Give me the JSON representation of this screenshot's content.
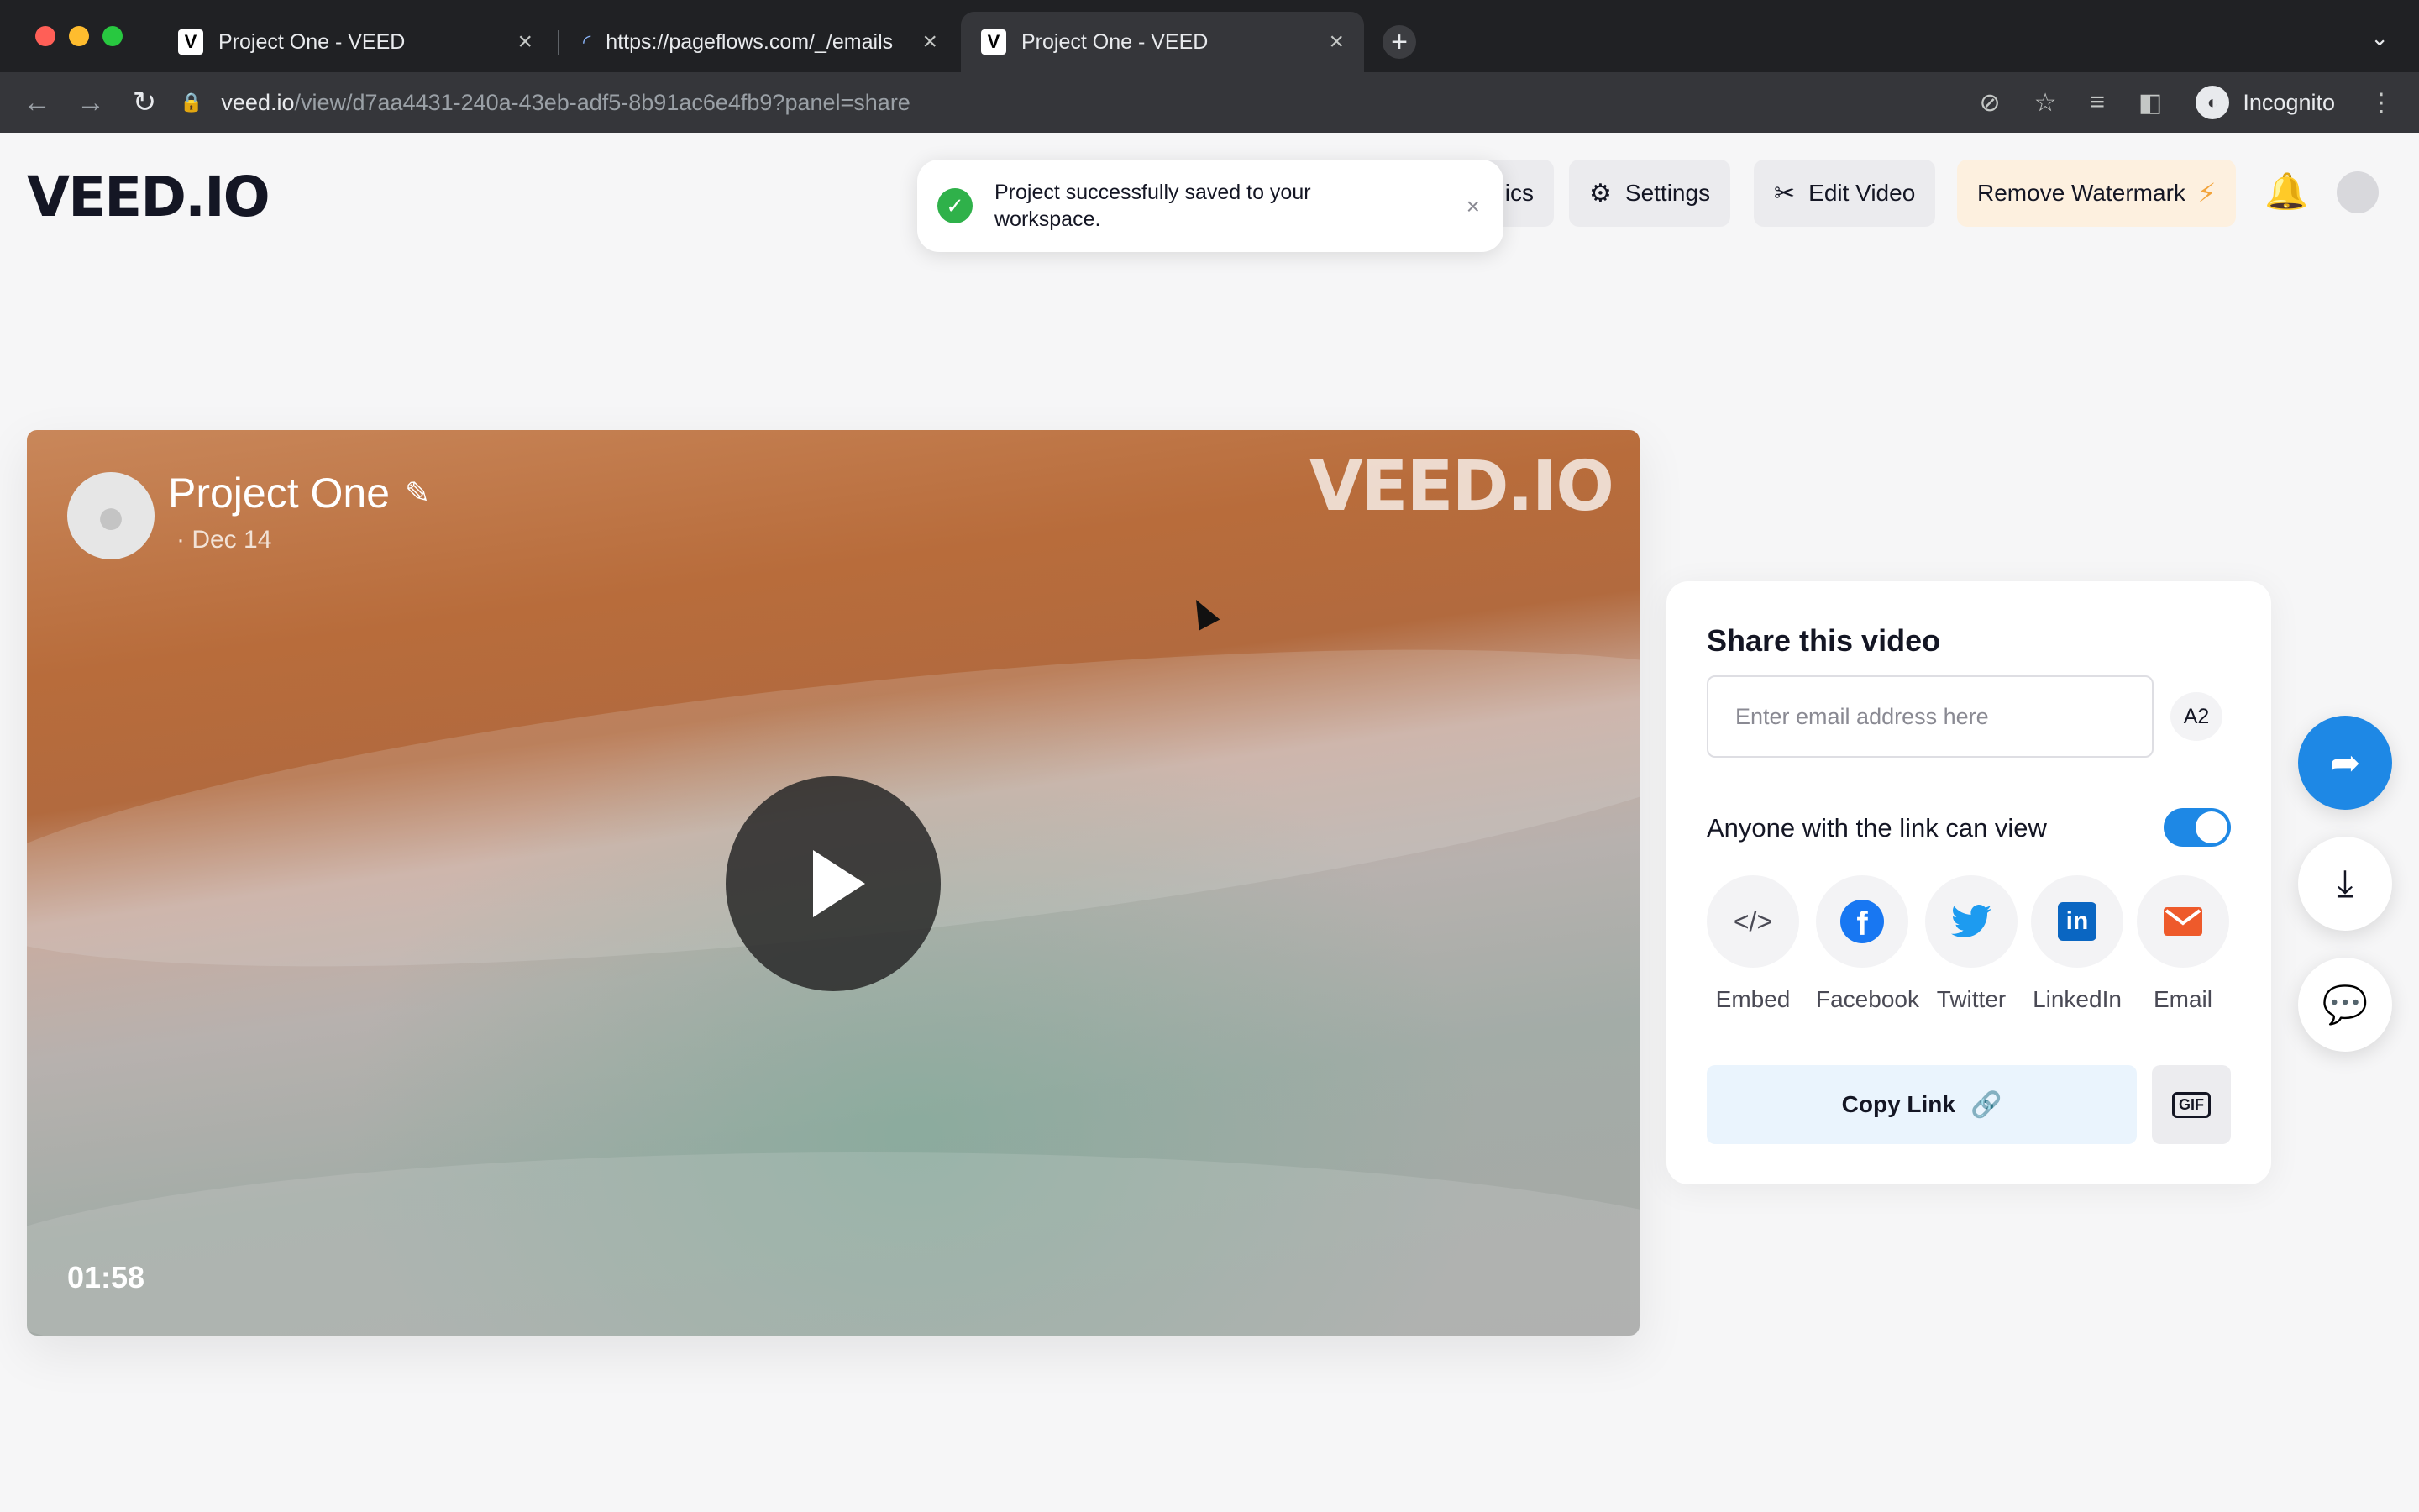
{
  "browser": {
    "tabs": [
      {
        "favicon": "V",
        "title": "Project One - VEED",
        "active": false
      },
      {
        "favicon": "loading-icon",
        "title": "https://pageflows.com/_/emails",
        "active": false
      },
      {
        "favicon": "V",
        "title": "Project One - VEED",
        "active": true
      }
    ],
    "url_domain": "veed.io",
    "url_path": "/view/d7aa4431-240a-43eb-adf5-8b91ac6e4fb9?panel=share",
    "incognito_label": "Incognito"
  },
  "header": {
    "logo": "VEED.IO",
    "analytics_label": "ics",
    "settings_label": "Settings",
    "edit_video_label": "Edit Video",
    "remove_watermark_label": "Remove Watermark"
  },
  "toast": {
    "message": "Project successfully saved to your workspace."
  },
  "video": {
    "title": "Project One",
    "date": "· Dec 14",
    "watermark": "VEED.IO",
    "duration": "01:58"
  },
  "share": {
    "title": "Share this video",
    "email_placeholder": "Enter email address here",
    "avatar_initials": "A2",
    "link_view_label": "Anyone with the link can view",
    "link_view_enabled": true,
    "social": [
      {
        "label": "Embed",
        "icon": "embed-icon",
        "color": "#4a4a55"
      },
      {
        "label": "Facebook",
        "icon": "facebook-icon",
        "color": "#1877f2"
      },
      {
        "label": "Twitter",
        "icon": "twitter-icon",
        "color": "#1d9bf0"
      },
      {
        "label": "LinkedIn",
        "icon": "linkedin-icon",
        "color": "#0a66c2"
      },
      {
        "label": "Email",
        "icon": "email-icon",
        "color": "#ee5a2b"
      }
    ],
    "copy_link_label": "Copy Link",
    "gif_label": "GIF"
  },
  "colors": {
    "accent": "#1e88e5",
    "success": "#2fb14a",
    "watermark_bolt": "#f2a33a"
  }
}
